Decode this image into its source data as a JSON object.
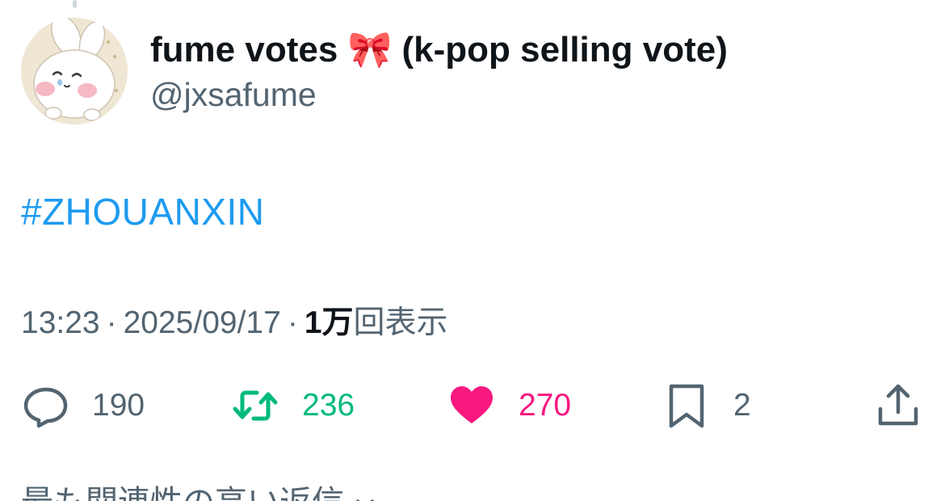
{
  "post": {
    "author": {
      "display_name": "fume votes 🎀 (k-pop selling vote)",
      "handle": "@jxsafume"
    },
    "text": "#ZHOUANXIN",
    "time": "13:23",
    "date": "2025/09/17",
    "separator": "·",
    "views_count": "1万",
    "views_label": "回表示",
    "actions": {
      "reply_count": "190",
      "retweet_count": "236",
      "like_count": "270",
      "bookmark_count": "2"
    }
  },
  "replies_section": {
    "label": "最も関連性の高い返信"
  },
  "colors": {
    "link": "#1d9bf0",
    "secondary_text": "#536471",
    "retweet_active": "#00ba7c",
    "like_active": "#f91880"
  },
  "icons": [
    "avatar-bunny",
    "reply-icon",
    "retweet-icon",
    "heart-icon",
    "bookmark-icon",
    "share-icon",
    "chevron-down-icon"
  ]
}
